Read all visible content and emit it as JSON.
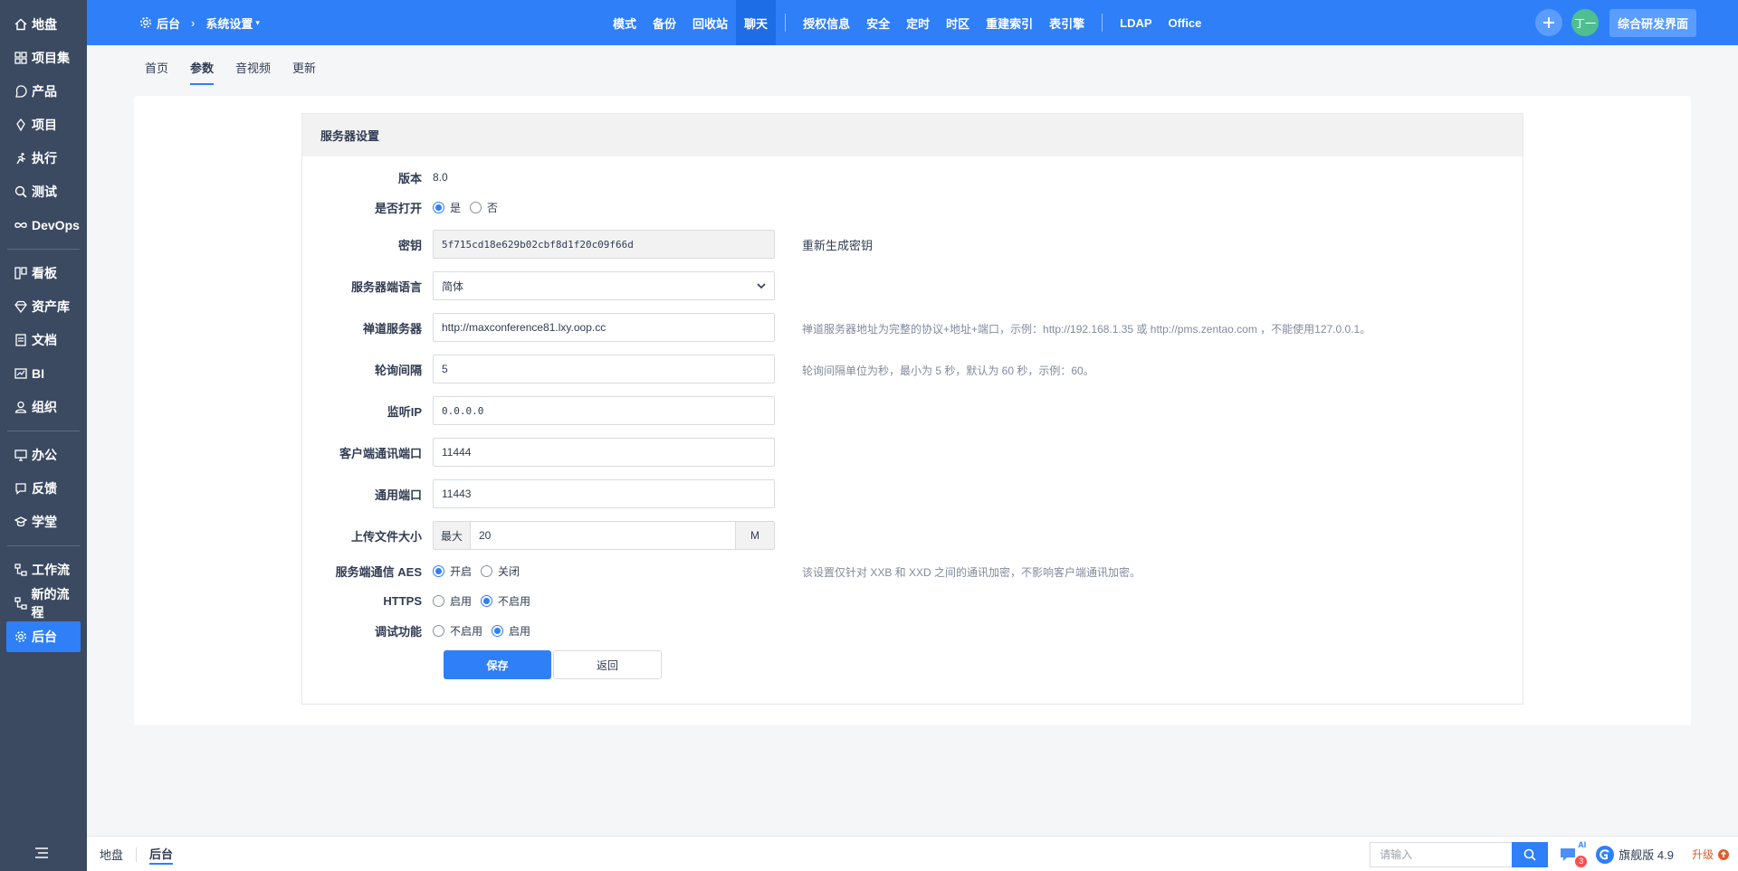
{
  "sidebar": {
    "items": [
      {
        "label": "地盘",
        "icon": "home-icon"
      },
      {
        "label": "项目集",
        "icon": "grid-icon"
      },
      {
        "label": "产品",
        "icon": "product-icon"
      },
      {
        "label": "项目",
        "icon": "project-icon"
      },
      {
        "label": "执行",
        "icon": "run-icon"
      },
      {
        "label": "测试",
        "icon": "test-icon"
      },
      {
        "label": "DevOps",
        "icon": "infinity-icon"
      },
      {
        "label": "看板",
        "icon": "kanban-icon"
      },
      {
        "label": "资产库",
        "icon": "diamond-icon"
      },
      {
        "label": "文档",
        "icon": "doc-icon"
      },
      {
        "label": "BI",
        "icon": "chart-icon"
      },
      {
        "label": "组织",
        "icon": "user-icon"
      },
      {
        "label": "办公",
        "icon": "office-icon"
      },
      {
        "label": "反馈",
        "icon": "feedback-icon"
      },
      {
        "label": "学堂",
        "icon": "school-icon"
      },
      {
        "label": "工作流",
        "icon": "workflow-icon"
      },
      {
        "label": "新的流程",
        "icon": "flow-icon"
      },
      {
        "label": "后台",
        "icon": "gear-icon"
      }
    ]
  },
  "topbar": {
    "crumb_root": "后台",
    "crumb_current": "系统设置",
    "nav": [
      "模式",
      "备份",
      "回收站",
      "聊天",
      "授权信息",
      "安全",
      "定时",
      "时区",
      "重建索引",
      "表引擎",
      "LDAP",
      "Office"
    ],
    "active_nav": "聊天",
    "avatar_text": "丁一",
    "switch_label": "综合研发界面"
  },
  "subtabs": [
    "首页",
    "参数",
    "音视频",
    "更新"
  ],
  "panel": {
    "title": "服务器设置",
    "version_label": "版本",
    "version_value": "8.0",
    "open_label": "是否打开",
    "open_yes": "是",
    "open_no": "否",
    "key_label": "密钥",
    "key_value": "5f715cd18e629b02cbf8d1f20c09f66d",
    "regen_key": "重新生成密钥",
    "lang_label": "服务器端语言",
    "lang_value": "简体",
    "server_label": "禅道服务器",
    "server_value": "http://maxconference81.lxy.oop.cc",
    "server_hint": "禅道服务器地址为完整的协议+地址+端口，示例：http://192.168.1.35 或 http://pms.zentao.com ，不能使用127.0.0.1。",
    "poll_label": "轮询间隔",
    "poll_value": "5",
    "poll_hint": "轮询间隔单位为秒，最小为 5 秒，默认为 60 秒，示例：60。",
    "ip_label": "监听IP",
    "ip_value": "0.0.0.0",
    "client_port_label": "客户端通讯端口",
    "client_port_value": "11444",
    "common_port_label": "通用端口",
    "common_port_value": "11443",
    "upload_label": "上传文件大小",
    "upload_prefix": "最大",
    "upload_value": "20",
    "upload_suffix": "M",
    "aes_label": "服务端通信 AES",
    "aes_on": "开启",
    "aes_off": "关闭",
    "aes_hint": "该设置仅针对 XXB 和 XXD 之间的通讯加密，不影响客户端通讯加密。",
    "https_label": "HTTPS",
    "https_on": "启用",
    "https_off": "不启用",
    "debug_label": "调试功能",
    "debug_off": "不启用",
    "debug_on": "启用",
    "save": "保存",
    "back": "返回"
  },
  "footer": {
    "crumb_home": "地盘",
    "crumb_admin": "后台",
    "search_placeholder": "请输入",
    "ai_label": "AI",
    "ai_badge": "3",
    "edition": "旗舰版 4.9",
    "upgrade": "升级"
  },
  "colors": {
    "primary": "#2e7ff8",
    "sidebar": "#3b4a61",
    "upgrade": "#e35a2a"
  }
}
